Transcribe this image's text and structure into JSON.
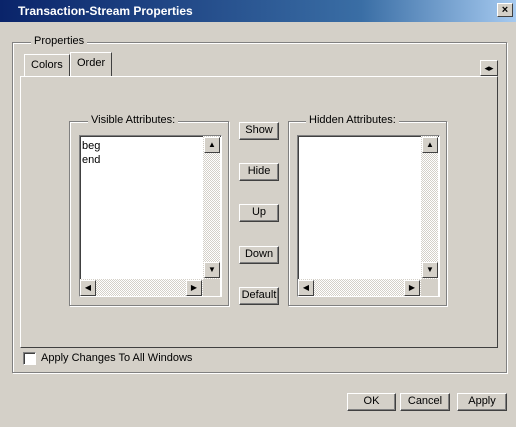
{
  "window": {
    "title": "Transaction-Stream Properties",
    "close_glyph": "×"
  },
  "properties_group": {
    "legend": "Properties"
  },
  "tabs": [
    {
      "label": "Colors",
      "active": false
    },
    {
      "label": "Order",
      "active": true
    }
  ],
  "tab_scroll_glyph": "◂▸",
  "visible_attributes": {
    "label": "Visible Attributes:",
    "items": [
      "beg",
      "end"
    ]
  },
  "hidden_attributes": {
    "label": "Hidden Attributes:",
    "items": []
  },
  "move_buttons": {
    "show": "Show",
    "hide": "Hide",
    "up": "Up",
    "down": "Down",
    "default": "Default"
  },
  "scroll_glyphs": {
    "up": "▲",
    "down": "▼",
    "left": "◀",
    "right": "▶"
  },
  "apply_all": {
    "label": "Apply Changes To All Windows",
    "checked": false
  },
  "footer": {
    "ok": "OK",
    "cancel": "Cancel",
    "apply": "Apply"
  }
}
